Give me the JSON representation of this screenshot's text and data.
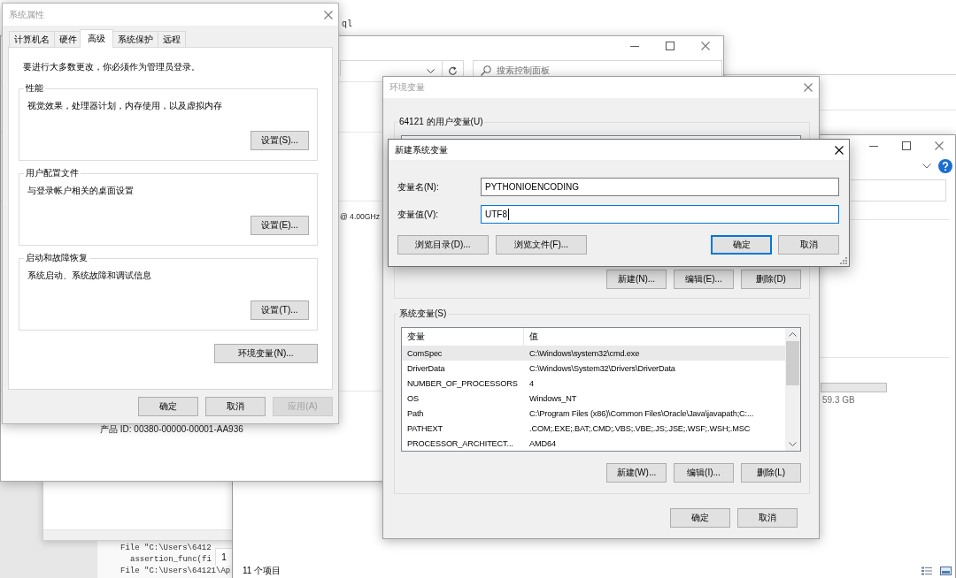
{
  "editor": {
    "top_code": "ql",
    "lines": [
      {
        "kind": "file",
        "text": "File \"C:\\Users\\6412"
      },
      {
        "kind": "call",
        "text": "assertion_func(fi"
      },
      {
        "kind": "file",
        "text": "File \"C:\\Users\\64121\\Ap"
      }
    ],
    "tab_number": "1"
  },
  "explorer": {
    "disk_free": "59.3 GB",
    "status_bar": "11 个项目"
  },
  "control_panel": {
    "search": {
      "placeholder": "搜索控制面板"
    },
    "processor": "@ 4.00GHz",
    "product_id": "产品 ID: 00380-00000-00001-AA936"
  },
  "system_properties": {
    "title": "系统属性",
    "active": false,
    "tabs": [
      {
        "label": "计算机名",
        "selected": false
      },
      {
        "label": "硬件",
        "selected": false
      },
      {
        "label": "高级",
        "selected": true
      },
      {
        "label": "系统保护",
        "selected": false
      },
      {
        "label": "远程",
        "selected": false
      }
    ],
    "notice": "要进行大多数更改，你必须作为管理员登录。",
    "groups": [
      {
        "title": "性能",
        "description": "视觉效果，处理器计划，内存使用，以及虚拟内存",
        "button": "设置(S)..."
      },
      {
        "title": "用户配置文件",
        "description": "与登录帐户相关的桌面设置",
        "button": "设置(E)..."
      },
      {
        "title": "启动和故障恢复",
        "description": "系统启动、系统故障和调试信息",
        "button": "设置(T)..."
      }
    ],
    "env_button": "环境变量(N)...",
    "buttons": [
      {
        "label": "确定",
        "disabled": false
      },
      {
        "label": "取消",
        "disabled": false
      },
      {
        "label": "应用(A)",
        "disabled": true
      }
    ]
  },
  "environment_variables": {
    "title": "环境变量",
    "active": false,
    "user_variables": {
      "title": "64121 的用户变量(U)",
      "buttons": [
        "新建(N)...",
        "编辑(E)...",
        "删除(D)"
      ]
    },
    "system_variables": {
      "title": "系统变量(S)",
      "columns": [
        "变量",
        "值"
      ],
      "rows": [
        {
          "name": "ComSpec",
          "value": "C:\\Windows\\system32\\cmd.exe",
          "selected": true
        },
        {
          "name": "DriverData",
          "value": "C:\\Windows\\System32\\Drivers\\DriverData",
          "selected": false
        },
        {
          "name": "NUMBER_OF_PROCESSORS",
          "value": "4",
          "selected": false
        },
        {
          "name": "OS",
          "value": "Windows_NT",
          "selected": false
        },
        {
          "name": "Path",
          "value": "C:\\Program Files (x86)\\Common Files\\Oracle\\Java\\javapath;C:...",
          "selected": false
        },
        {
          "name": "PATHEXT",
          "value": ".COM;.EXE;.BAT;.CMD;.VBS;.VBE;.JS;.JSE;.WSF;.WSH;.MSC",
          "selected": false
        },
        {
          "name": "PROCESSOR_ARCHITECT...",
          "value": "AMD64",
          "selected": false
        }
      ],
      "buttons": [
        "新建(W)...",
        "编辑(I)...",
        "删除(L)"
      ]
    },
    "buttons": [
      "确定",
      "取消"
    ]
  },
  "new_variable_dialog": {
    "title": "新建系统变量",
    "active": true,
    "fields": [
      {
        "label": "变量名(N):",
        "value": "PYTHONIOENCODING",
        "focused": false
      },
      {
        "label": "变量值(V):",
        "value": "UTF8",
        "focused": true
      }
    ],
    "browse_buttons": [
      "浏览目录(D)...",
      "浏览文件(F)..."
    ],
    "buttons": [
      {
        "label": "确定",
        "default": true
      },
      {
        "label": "取消",
        "default": false
      }
    ]
  }
}
